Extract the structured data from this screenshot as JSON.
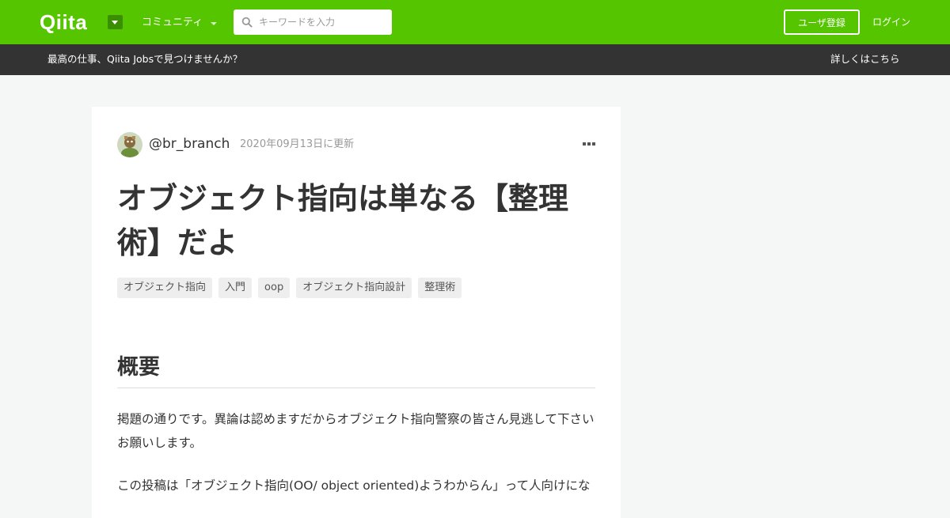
{
  "colors": {
    "brand": "#55c500",
    "brand_dark": "#3a8f00",
    "jobs_bar": "#333333",
    "page_bg": "#f5f6f6"
  },
  "header": {
    "logo_text": "Qiita",
    "logo_dropdown_icon": "caret-down-icon",
    "community_label": "コミュニティ",
    "search": {
      "icon": "search-icon",
      "placeholder": "キーワードを入力",
      "value": ""
    },
    "signup_label": "ユーザ登録",
    "login_label": "ログイン"
  },
  "jobs_banner": {
    "text": "最高の仕事、Qiita Jobsで見つけませんか？",
    "link_label": "詳しくはこちら"
  },
  "article": {
    "author": "@br_branch",
    "updated": "2020年09月13日に更新",
    "more_icon": "more-horizontal-icon",
    "title": "オブジェクト指向は単なる【整理術】だよ",
    "tags": [
      "オブジェクト指向",
      "入門",
      "oop",
      "オブジェクト指向設計",
      "整理術"
    ],
    "section_heading": "概要",
    "paragraphs": [
      "掲題の通りです。異論は認めますだからオブジェクト指向警察の皆さん見逃して下さいお願いします。",
      "この投稿は「オブジェクト指向(OO/ object oriented)ようわからん」って人向けにな"
    ]
  }
}
